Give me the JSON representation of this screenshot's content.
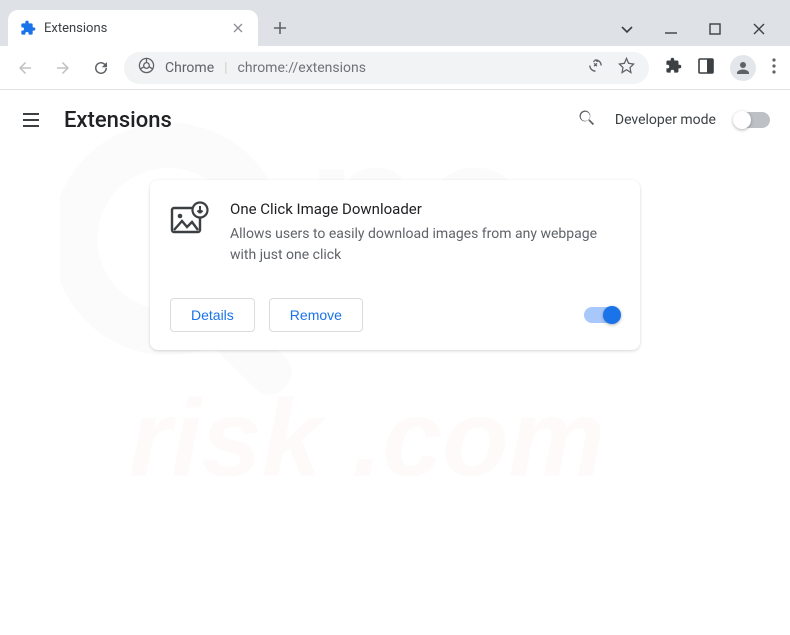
{
  "tab": {
    "title": "Extensions"
  },
  "omnibox": {
    "prefix": "Chrome",
    "url": "chrome://extensions"
  },
  "page": {
    "title": "Extensions",
    "developer_mode_label": "Developer mode",
    "developer_mode_on": false
  },
  "extension": {
    "name": "One Click Image Downloader",
    "description": "Allows users to easily download images from any webpage with just one click",
    "enabled": true,
    "details_label": "Details",
    "remove_label": "Remove"
  }
}
